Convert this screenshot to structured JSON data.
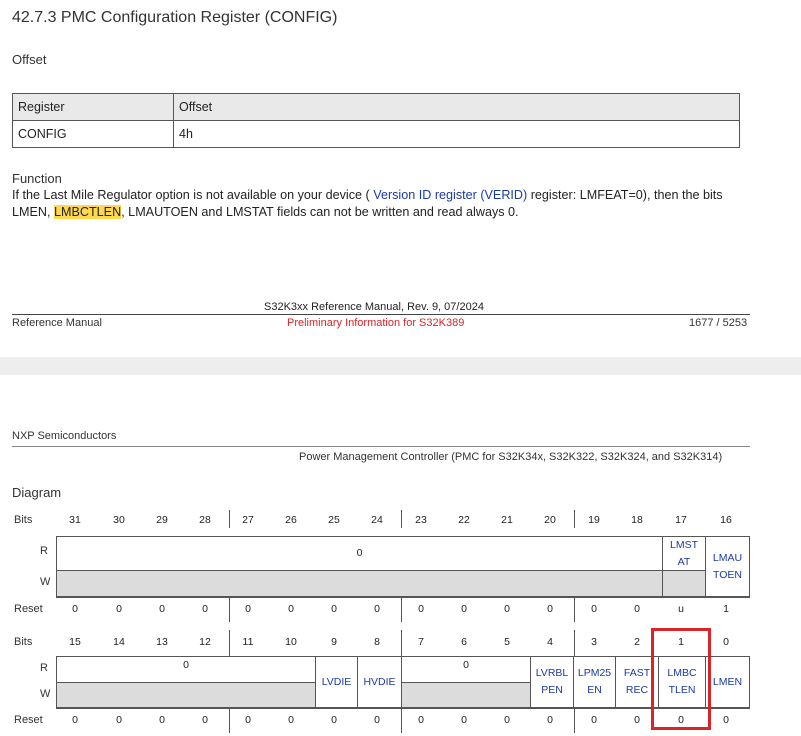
{
  "section_title": "42.7.3  PMC Configuration Register (CONFIG)",
  "offset_heading": "Offset",
  "offset_table": {
    "headers": [
      "Register",
      "Offset"
    ],
    "row": [
      "CONFIG",
      "4h"
    ]
  },
  "function_heading": "Function",
  "function_text": {
    "part1": "If the Last Mile Regulator option is not available on your device ( ",
    "link": "Version ID register (VERID)",
    "part2": " register: LMFEAT=0), then the bits LMEN, ",
    "highlight": "LMBCTLEN",
    "part3": ", LMAUTOEN and LMSTAT fields can not be written and read always 0."
  },
  "footer": {
    "manual_title": "S32K3xx Reference Manual, Rev. 9, 07/2024",
    "left": "Reference Manual",
    "center": "Preliminary Information for S32K389",
    "page": "1677 / 5253"
  },
  "header2": {
    "company": "NXP Semiconductors",
    "chapter": "Power Management Controller (PMC for S32K34x, S32K322, S32K324, and S32K314)"
  },
  "diagram_heading": "Diagram",
  "row_labels": {
    "bits": "Bits",
    "r": "R",
    "w": "W",
    "reset": "Reset"
  },
  "upper": {
    "bits": [
      "31",
      "30",
      "29",
      "28",
      "27",
      "26",
      "25",
      "24",
      "23",
      "22",
      "21",
      "20",
      "19",
      "18",
      "17",
      "16"
    ],
    "reserved_value": "0",
    "field_17": "LMST AT",
    "field_16": "LMAU TOEN",
    "reset": [
      "0",
      "0",
      "0",
      "0",
      "0",
      "0",
      "0",
      "0",
      "0",
      "0",
      "0",
      "0",
      "0",
      "0",
      "u",
      "1"
    ]
  },
  "lower": {
    "bits": [
      "15",
      "14",
      "13",
      "12",
      "11",
      "10",
      "9",
      "8",
      "7",
      "6",
      "5",
      "4",
      "3",
      "2",
      "1",
      "0"
    ],
    "reserved_a": "0",
    "reserved_b": "0",
    "fields": {
      "b9": "LVDIE",
      "b8": "HVDIE",
      "b4": "LVRBL PEN",
      "b3": "LPM25 EN",
      "b2": "FAST REC",
      "b1": "LMBC TLEN",
      "b0": "LMEN"
    },
    "reset": [
      "0",
      "0",
      "0",
      "0",
      "0",
      "0",
      "0",
      "0",
      "0",
      "0",
      "0",
      "0",
      "0",
      "0",
      "0",
      "0"
    ]
  },
  "colors": {
    "link": "#1a3aa6",
    "highlight": "#ffd84d",
    "emphasis_box": "#d9252a",
    "footer_center": "#d9252a"
  }
}
